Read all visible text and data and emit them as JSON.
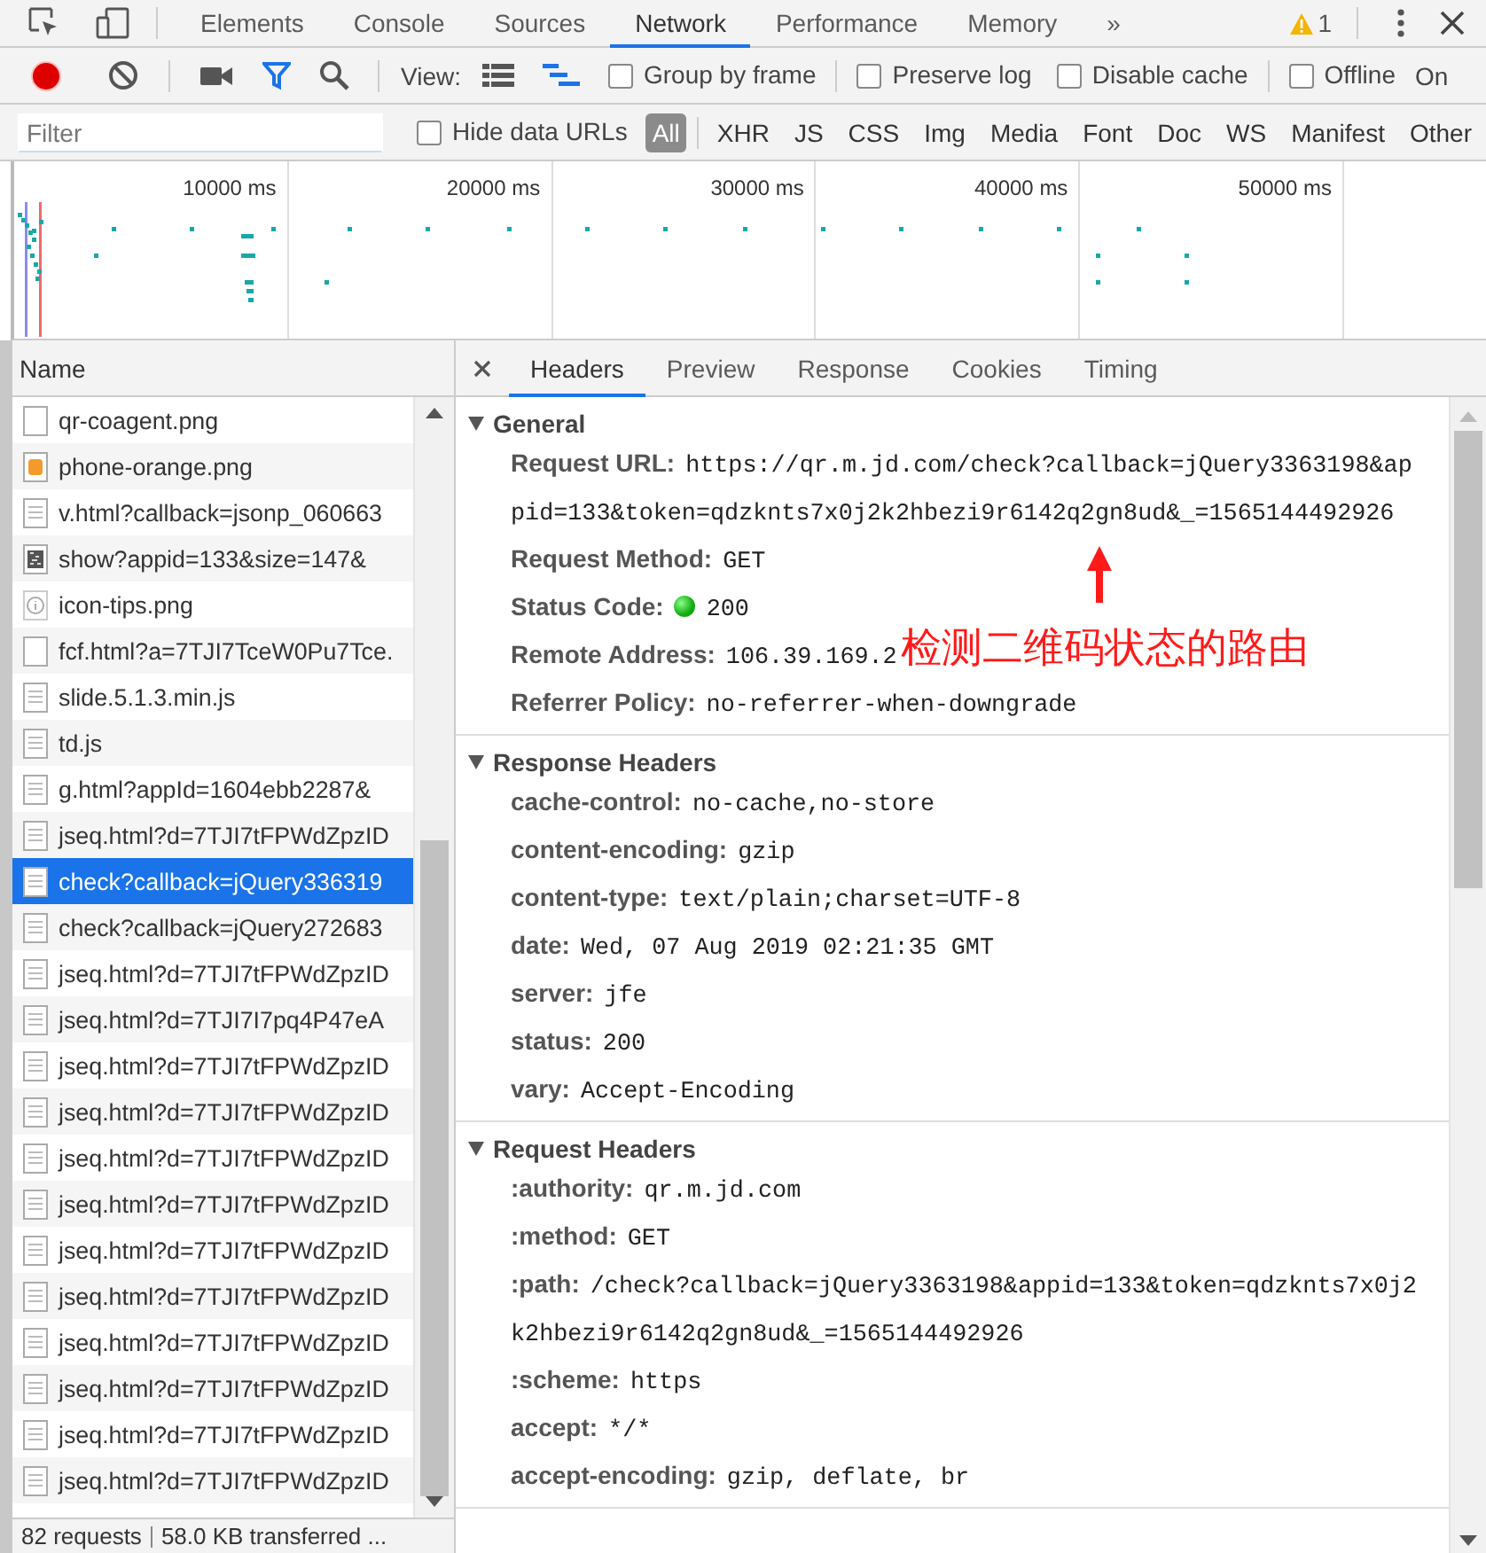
{
  "top_tabs": [
    {
      "label": "Elements",
      "selected": false
    },
    {
      "label": "Console",
      "selected": false
    },
    {
      "label": "Sources",
      "selected": false
    },
    {
      "label": "Network",
      "selected": true
    },
    {
      "label": "Performance",
      "selected": false
    },
    {
      "label": "Memory",
      "selected": false
    }
  ],
  "more_tabs": "»",
  "warning_count": "1",
  "toolbar": {
    "recording": true,
    "filter_active": true,
    "view_label": "View:",
    "large_rows": false,
    "waterfall": true,
    "options": [
      {
        "label": "Group by frame",
        "checked": false,
        "divider_before": false
      },
      {
        "label": "Preserve log",
        "checked": false,
        "divider_before": true
      },
      {
        "label": "Disable cache",
        "checked": false,
        "divider_before": false
      },
      {
        "label": "Offline",
        "checked": false,
        "divider_before": true
      }
    ],
    "throttling": "On"
  },
  "filter_bar": {
    "placeholder": "Filter",
    "hide_data_urls": {
      "label": "Hide data URLs",
      "checked": false
    },
    "types": [
      {
        "label": "All",
        "selected": true
      },
      {
        "label": "XHR",
        "selected": false
      },
      {
        "label": "JS",
        "selected": false
      },
      {
        "label": "CSS",
        "selected": false
      },
      {
        "label": "Img",
        "selected": false
      },
      {
        "label": "Media",
        "selected": false
      },
      {
        "label": "Font",
        "selected": false
      },
      {
        "label": "Doc",
        "selected": false
      },
      {
        "label": "WS",
        "selected": false
      },
      {
        "label": "Manifest",
        "selected": false
      },
      {
        "label": "Other",
        "selected": false
      }
    ]
  },
  "overview": {
    "ticks": [
      "10000 ms",
      "20000 ms",
      "30000 ms",
      "40000 ms",
      "50000 ms"
    ]
  },
  "requests": {
    "column": "Name",
    "rows": [
      {
        "name": "qr-coagent.png",
        "kind": "blank",
        "selected": false
      },
      {
        "name": "phone-orange.png",
        "kind": "image",
        "selected": false
      },
      {
        "name": "v.html?callback=jsonp_060663",
        "kind": "doc",
        "selected": false
      },
      {
        "name": "show?appid=133&size=147&",
        "kind": "qr",
        "selected": false
      },
      {
        "name": "icon-tips.png",
        "kind": "info",
        "selected": false
      },
      {
        "name": "fcf.html?a=7TJI7TceW0Pu7Tce.",
        "kind": "blank",
        "selected": false
      },
      {
        "name": "slide.5.1.3.min.js",
        "kind": "doc",
        "selected": false
      },
      {
        "name": "td.js",
        "kind": "doc",
        "selected": false
      },
      {
        "name": "g.html?appId=1604ebb2287&",
        "kind": "doc",
        "selected": false
      },
      {
        "name": "jseq.html?d=7TJI7tFPWdZpzID",
        "kind": "doc",
        "selected": false
      },
      {
        "name": "check?callback=jQuery336319",
        "kind": "doc",
        "selected": true
      },
      {
        "name": "check?callback=jQuery272683",
        "kind": "doc",
        "selected": false
      },
      {
        "name": "jseq.html?d=7TJI7tFPWdZpzID",
        "kind": "doc",
        "selected": false
      },
      {
        "name": "jseq.html?d=7TJI7I7pq4P47eA",
        "kind": "doc",
        "selected": false
      },
      {
        "name": "jseq.html?d=7TJI7tFPWdZpzID",
        "kind": "doc",
        "selected": false
      },
      {
        "name": "jseq.html?d=7TJI7tFPWdZpzID",
        "kind": "doc",
        "selected": false
      },
      {
        "name": "jseq.html?d=7TJI7tFPWdZpzID",
        "kind": "doc",
        "selected": false
      },
      {
        "name": "jseq.html?d=7TJI7tFPWdZpzID",
        "kind": "doc",
        "selected": false
      },
      {
        "name": "jseq.html?d=7TJI7tFPWdZpzID",
        "kind": "doc",
        "selected": false
      },
      {
        "name": "jseq.html?d=7TJI7tFPWdZpzID",
        "kind": "doc",
        "selected": false
      },
      {
        "name": "jseq.html?d=7TJI7tFPWdZpzID",
        "kind": "doc",
        "selected": false
      },
      {
        "name": "jseq.html?d=7TJI7tFPWdZpzID",
        "kind": "doc",
        "selected": false
      },
      {
        "name": "jseq.html?d=7TJI7tFPWdZpzID",
        "kind": "doc",
        "selected": false
      },
      {
        "name": "jseq.html?d=7TJI7tFPWdZpzID",
        "kind": "doc",
        "selected": false
      }
    ]
  },
  "status_bar": {
    "requests": "82 requests",
    "transferred": "58.0 KB transferred ..."
  },
  "detail": {
    "tabs": [
      {
        "label": "Headers",
        "selected": true
      },
      {
        "label": "Preview",
        "selected": false
      },
      {
        "label": "Response",
        "selected": false
      },
      {
        "label": "Cookies",
        "selected": false
      },
      {
        "label": "Timing",
        "selected": false
      }
    ],
    "sections": [
      {
        "title": "General",
        "expanded": true,
        "rows": [
          {
            "key": "Request URL:",
            "value": "https://qr.m.jd.com/check?callback=jQuery3363198&appid=133&token=qdzknts7x0j2k2hbezi9r6142q2gn8ud&_=1565144492926",
            "kind": "plain"
          },
          {
            "key": "Request Method:",
            "value": "GET",
            "kind": "plain"
          },
          {
            "key": "Status Code:",
            "value": "200",
            "kind": "status"
          },
          {
            "key": "Remote Address:",
            "value": "106.39.169.2",
            "kind": "plain"
          },
          {
            "key": "Referrer Policy:",
            "value": "no-referrer-when-downgrade",
            "kind": "plain"
          }
        ]
      },
      {
        "title": "Response Headers",
        "expanded": true,
        "rows": [
          {
            "key": "cache-control:",
            "value": "no-cache,no-store",
            "kind": "plain"
          },
          {
            "key": "content-encoding:",
            "value": "gzip",
            "kind": "plain"
          },
          {
            "key": "content-type:",
            "value": "text/plain;charset=UTF-8",
            "kind": "plain"
          },
          {
            "key": "date:",
            "value": "Wed, 07 Aug 2019 02:21:35 GMT",
            "kind": "plain"
          },
          {
            "key": "server:",
            "value": "jfe",
            "kind": "plain"
          },
          {
            "key": "status:",
            "value": "200",
            "kind": "plain"
          },
          {
            "key": "vary:",
            "value": "Accept-Encoding",
            "kind": "plain"
          }
        ]
      },
      {
        "title": "Request Headers",
        "expanded": true,
        "rows": [
          {
            "key": ":authority:",
            "value": "qr.m.jd.com",
            "kind": "plain"
          },
          {
            "key": ":method:",
            "value": "GET",
            "kind": "plain"
          },
          {
            "key": ":path:",
            "value": "/check?callback=jQuery3363198&appid=133&token=qdzknts7x0j2k2hbezi9r6142q2gn8ud&_=1565144492926",
            "kind": "plain"
          },
          {
            "key": ":scheme:",
            "value": "https",
            "kind": "plain"
          },
          {
            "key": "accept:",
            "value": "*/*",
            "kind": "plain"
          },
          {
            "key": "accept-encoding:",
            "value": "gzip, deflate, br",
            "kind": "plain"
          }
        ]
      }
    ]
  },
  "annotation": {
    "text": "检测二维码状态的路由"
  }
}
